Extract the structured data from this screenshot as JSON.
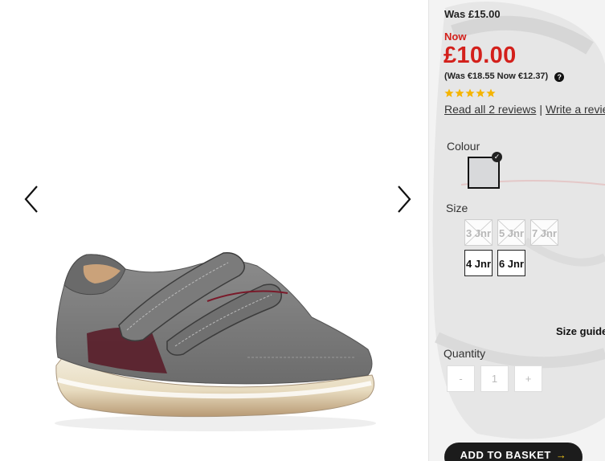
{
  "gallery": {
    "prev_icon": "chevron-left-icon",
    "next_icon": "chevron-right-icon",
    "image_icon": "shoe-product-image"
  },
  "price": {
    "was": "Was £15.00",
    "now_label": "Now",
    "now": "£10.00",
    "euro_line": "(Was €18.55 Now €12.37)",
    "help_icon": "?"
  },
  "rating": {
    "stars": 5,
    "max": 5,
    "star_color": "#f5b400"
  },
  "reviews": {
    "read_label": "Read all 2 reviews",
    "separator": "|",
    "write_label": "Write a review"
  },
  "colour": {
    "label": "Colour",
    "selected_swatch_color": "#d8d9db",
    "check_icon": "✓"
  },
  "size": {
    "label": "Size",
    "options": [
      {
        "label": "3 Jnr",
        "available": false
      },
      {
        "label": "5 Jnr",
        "available": false
      },
      {
        "label": "7 Jnr",
        "available": false
      },
      {
        "label": "4 Jnr",
        "available": true
      },
      {
        "label": "6 Jnr",
        "available": true
      }
    ],
    "guide_label": "Size guide"
  },
  "quantity": {
    "label": "Quantity",
    "minus": "-",
    "value": "1",
    "plus": "+"
  },
  "basket": {
    "label": "ADD TO BASKET",
    "arrow": "→"
  },
  "colors": {
    "price_red": "#d3201b",
    "button_dark": "#1c1c1c",
    "arrow_yellow": "#f0c419"
  }
}
